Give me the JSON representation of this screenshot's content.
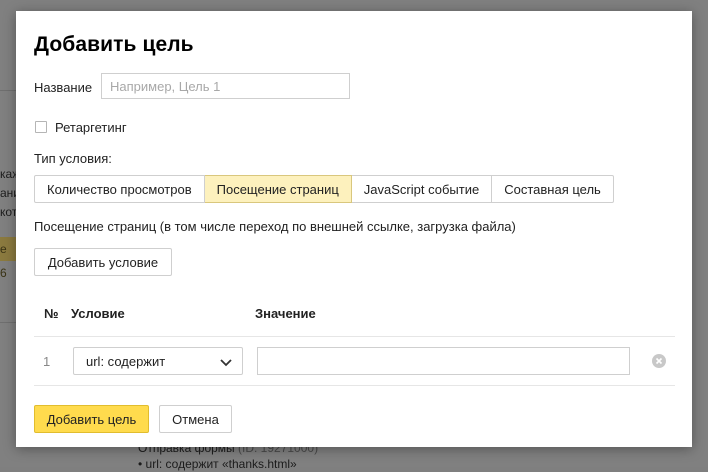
{
  "background": {
    "fragments": [
      "каж",
      "ани",
      "кот"
    ],
    "tag": "е 6",
    "bottom_line1": "Отправка формы",
    "bottom_id": "(ID: 19271000)",
    "bottom_line2": "• url: содержит «thanks.html»"
  },
  "dialog": {
    "title": "Добавить цель",
    "name_label": "Название",
    "name_placeholder": "Например, Цель 1",
    "name_value": "",
    "retargeting_label": "Ретаргетинг",
    "retargeting_checked": false,
    "condition_type_label": "Тип условия:",
    "condition_types": [
      {
        "label": "Количество просмотров",
        "active": false
      },
      {
        "label": "Посещение страниц",
        "active": true
      },
      {
        "label": "JavaScript событие",
        "active": false
      },
      {
        "label": "Составная цель",
        "active": false
      }
    ],
    "description": "Посещение страниц (в том числе переход по внешней ссылке, загрузка файла)",
    "add_condition_label": "Добавить условие",
    "table": {
      "headers": {
        "no": "№",
        "condition": "Условие",
        "value": "Значение"
      },
      "rows": [
        {
          "num": "1",
          "condition": "url: содержит",
          "value": ""
        }
      ]
    },
    "submit_label": "Добавить цель",
    "cancel_label": "Отмена"
  },
  "colors": {
    "overlay": "#808080",
    "active_segment": "#fdf1bd",
    "primary_button": "#ffdb4d"
  }
}
